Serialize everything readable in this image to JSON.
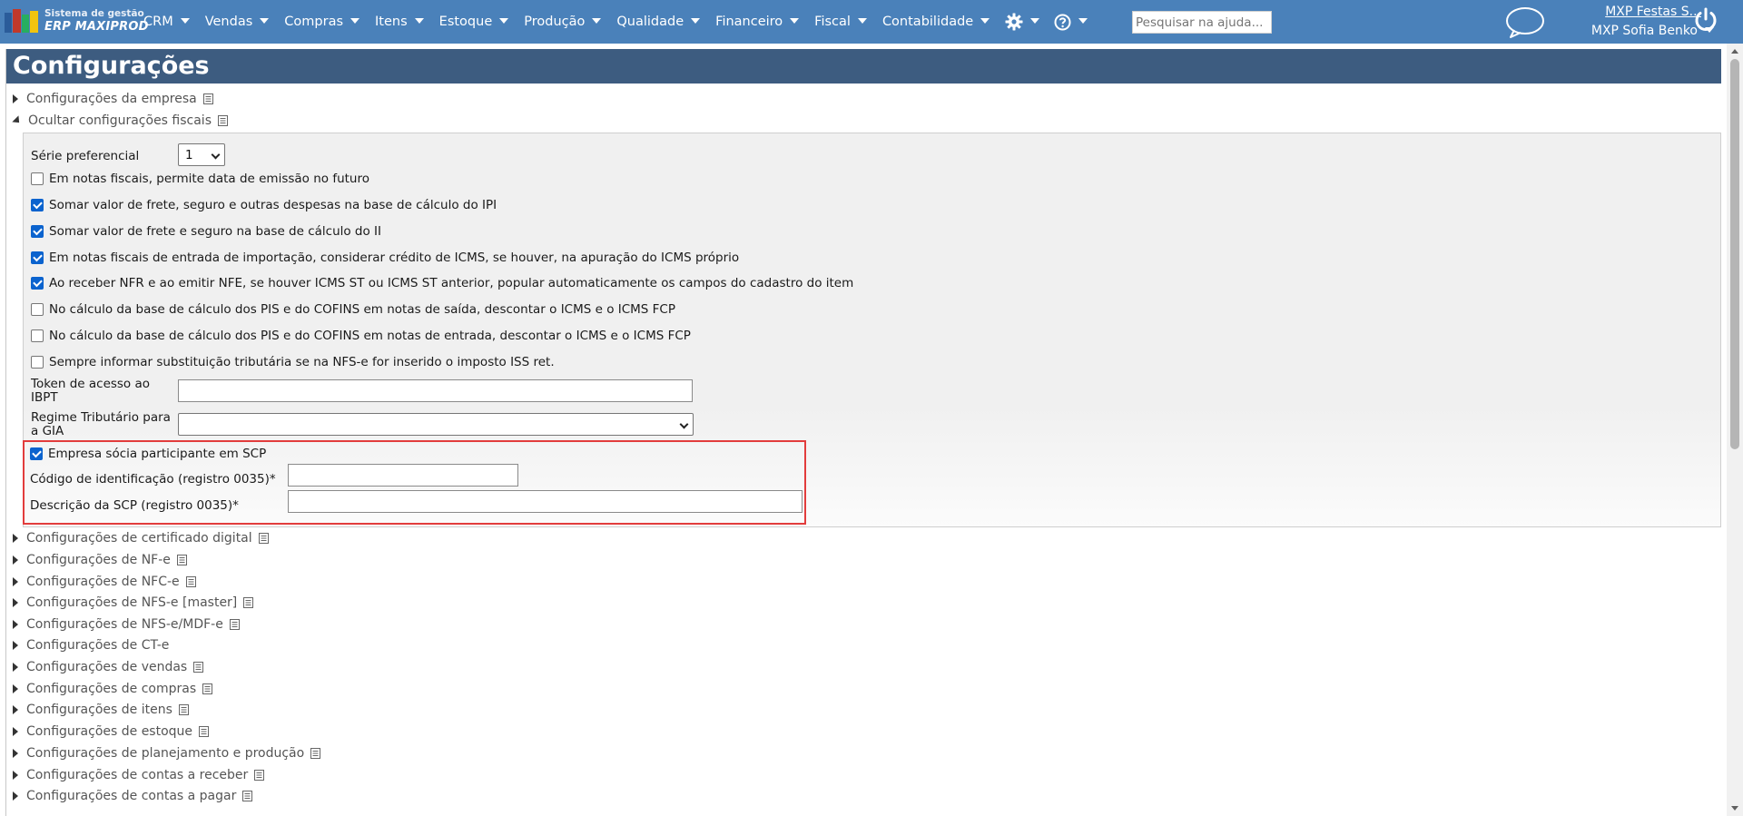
{
  "app": {
    "logo_line1": "Sistema de gestão",
    "logo_line2": "ERP MAXIPROD"
  },
  "menu": {
    "items": [
      {
        "label": "CRM"
      },
      {
        "label": "Vendas"
      },
      {
        "label": "Compras"
      },
      {
        "label": "Itens"
      },
      {
        "label": "Estoque"
      },
      {
        "label": "Produção"
      },
      {
        "label": "Qualidade"
      },
      {
        "label": "Financeiro"
      },
      {
        "label": "Fiscal"
      },
      {
        "label": "Contabilidade"
      }
    ],
    "settings_icon": "gear-icon",
    "help_icon": "help-circle-icon"
  },
  "search": {
    "placeholder": "Pesquisar na ajuda..."
  },
  "user": {
    "company": "MXP Festas S...",
    "name": "MXP Sofia Benko",
    "chat_icon": "chat-bubble-icon",
    "power_icon": "power-icon"
  },
  "page": {
    "title": "Configurações"
  },
  "sections_top": [
    {
      "label": "Configurações da empresa",
      "expanded": false
    },
    {
      "label": "Ocultar configurações fiscais",
      "expanded": true
    }
  ],
  "fiscal": {
    "serie_label": "Série preferencial",
    "serie_value": "1",
    "checkboxes": [
      {
        "label": "Em notas fiscais, permite data de emissão no futuro",
        "checked": false
      },
      {
        "label": "Somar valor de frete, seguro e outras despesas na base de cálculo do IPI",
        "checked": true
      },
      {
        "label": "Somar valor de frete e seguro na base de cálculo do II",
        "checked": true
      },
      {
        "label": "Em notas fiscais de entrada de importação, considerar crédito de ICMS, se houver, na apuração do ICMS próprio",
        "checked": true
      },
      {
        "label": "Ao receber NFR e ao emitir NFE, se houver ICMS ST ou ICMS ST anterior, popular automaticamente os campos do cadastro do item",
        "checked": true
      },
      {
        "label": "No cálculo da base de cálculo dos PIS e do COFINS em notas de saída, descontar o ICMS e o ICMS FCP",
        "checked": false
      },
      {
        "label": "No cálculo da base de cálculo dos PIS e do COFINS em notas de entrada, descontar o ICMS e o ICMS FCP",
        "checked": false
      },
      {
        "label": "Sempre informar substituição tributária se na NFS-e for inserido o imposto ISS ret.",
        "checked": false
      }
    ],
    "token_label": "Token de acesso ao IBPT",
    "token_value": "",
    "regime_label": "Regime Tributário para a GIA",
    "regime_value": "",
    "scp": {
      "checkbox_label": "Empresa sócia participante em SCP",
      "checked": true,
      "codigo_label": "Código de identificação (registro 0035)*",
      "codigo_value": "",
      "descricao_label": "Descrição da SCP (registro 0035)*",
      "descricao_value": ""
    }
  },
  "sections_bottom": [
    {
      "label": "Configurações de certificado digital",
      "doc": true
    },
    {
      "label": "Configurações de NF-e",
      "doc": true
    },
    {
      "label": "Configurações de NFC-e",
      "doc": true
    },
    {
      "label": "Configurações de NFS-e [master]",
      "doc": true
    },
    {
      "label": "Configurações de NFS-e/MDF-e",
      "doc": true
    },
    {
      "label": "Configurações de CT-e",
      "doc": false
    },
    {
      "label": "Configurações de vendas",
      "doc": true
    },
    {
      "label": "Configurações de compras",
      "doc": true
    },
    {
      "label": "Configurações de itens",
      "doc": true
    },
    {
      "label": "Configurações de estoque",
      "doc": true
    },
    {
      "label": "Configurações de planejamento e produção",
      "doc": true
    },
    {
      "label": "Configurações de contas a receber",
      "doc": true
    },
    {
      "label": "Configurações de contas a pagar",
      "doc": true
    }
  ],
  "colors": {
    "topbar": "#4a81ba",
    "header": "#3d5c80",
    "highlight_border": "#e23c3c",
    "checkbox_checked": "#0b63ce"
  }
}
